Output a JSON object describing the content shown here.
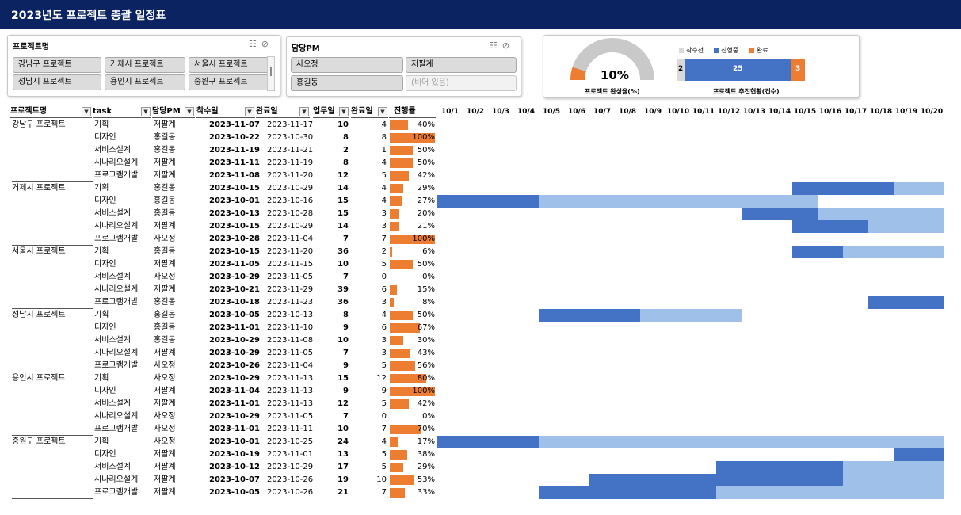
{
  "title": "2023년도 프로젝트 총괄 일정표",
  "slicer_project": {
    "header": "프로젝트명",
    "items": [
      "강남구 프로젝트",
      "거제시 프로젝트",
      "서울시 프로젝트",
      "성남시 프로젝트",
      "용인시 프로젝트",
      "중원구 프로젝트"
    ]
  },
  "slicer_pm": {
    "header": "담당PM",
    "items": [
      "사오정",
      "저팔계",
      "홍길동",
      "(비어 있음)"
    ]
  },
  "kpi": {
    "completion_pct": "10%",
    "completion_value": 0.1,
    "completion_label": "프로젝트 완성율(%)",
    "status_label": "프로젝트 추진현황(건수)",
    "legend": [
      "착수전",
      "진행중",
      "완료"
    ],
    "colors": {
      "before": "#d9d9d9",
      "ongoing": "#4472c4",
      "done": "#ed7d31"
    },
    "counts": {
      "before": "2",
      "ongoing": "25",
      "done": "3"
    }
  },
  "columns": {
    "project": "프로젝트명",
    "task": "task",
    "pm": "담당PM",
    "start": "착수일",
    "end": "완료일",
    "workdays": "업무일",
    "donedays": "완료일",
    "progress": "진행률"
  },
  "dates": [
    "10/1",
    "10/2",
    "10/3",
    "10/4",
    "10/5",
    "10/6",
    "10/7",
    "10/8",
    "10/9",
    "10/10",
    "10/11",
    "10/12",
    "10/13",
    "10/14",
    "10/15",
    "10/16",
    "10/17",
    "10/18",
    "10/19",
    "10/20"
  ],
  "colors": {
    "progress": "#ed7d31",
    "gantt_done": "#4472c4",
    "gantt_remaining": "#9fc0e8",
    "header_bg": "#0b2461"
  },
  "groups": [
    {
      "name": "강남구 프로젝트",
      "rows": [
        {
          "task": "기획",
          "pm": "저팔계",
          "start": "2023-11-07",
          "end": "2023-11-17",
          "wd": "10",
          "cd": "4",
          "pct": "40%"
        },
        {
          "task": "디자인",
          "pm": "홍길동",
          "start": "2023-10-22",
          "end": "2023-10-30",
          "wd": "8",
          "cd": "8",
          "pct": "100%"
        },
        {
          "task": "서비스설계",
          "pm": "홍길동",
          "start": "2023-11-19",
          "end": "2023-11-21",
          "wd": "2",
          "cd": "1",
          "pct": "50%"
        },
        {
          "task": "시나리오설계",
          "pm": "저팔계",
          "start": "2023-11-11",
          "end": "2023-11-19",
          "wd": "8",
          "cd": "4",
          "pct": "50%"
        },
        {
          "task": "프로그램개발",
          "pm": "저팔계",
          "start": "2023-11-08",
          "end": "2023-11-20",
          "wd": "12",
          "cd": "5",
          "pct": "42%"
        }
      ]
    },
    {
      "name": "거제시 프로젝트",
      "rows": [
        {
          "task": "기획",
          "pm": "홍길동",
          "start": "2023-10-15",
          "end": "2023-10-29",
          "wd": "14",
          "cd": "4",
          "pct": "29%"
        },
        {
          "task": "디자인",
          "pm": "홍길동",
          "start": "2023-10-01",
          "end": "2023-10-16",
          "wd": "15",
          "cd": "4",
          "pct": "27%"
        },
        {
          "task": "서비스설계",
          "pm": "홍길동",
          "start": "2023-10-13",
          "end": "2023-10-28",
          "wd": "15",
          "cd": "3",
          "pct": "20%"
        },
        {
          "task": "시나리오설계",
          "pm": "저팔계",
          "start": "2023-10-15",
          "end": "2023-10-29",
          "wd": "14",
          "cd": "3",
          "pct": "21%"
        },
        {
          "task": "프로그램개발",
          "pm": "사오정",
          "start": "2023-10-28",
          "end": "2023-11-04",
          "wd": "7",
          "cd": "7",
          "pct": "100%"
        }
      ]
    },
    {
      "name": "서울시 프로젝트",
      "rows": [
        {
          "task": "기획",
          "pm": "홍길동",
          "start": "2023-10-15",
          "end": "2023-11-20",
          "wd": "36",
          "cd": "2",
          "pct": "6%"
        },
        {
          "task": "디자인",
          "pm": "저팔계",
          "start": "2023-11-05",
          "end": "2023-11-15",
          "wd": "10",
          "cd": "5",
          "pct": "50%"
        },
        {
          "task": "서비스설계",
          "pm": "사오정",
          "start": "2023-10-29",
          "end": "2023-11-05",
          "wd": "7",
          "cd": "0",
          "pct": "0%"
        },
        {
          "task": "시나리오설계",
          "pm": "저팔계",
          "start": "2023-10-21",
          "end": "2023-11-29",
          "wd": "39",
          "cd": "6",
          "pct": "15%"
        },
        {
          "task": "프로그램개발",
          "pm": "홍길동",
          "start": "2023-10-18",
          "end": "2023-11-23",
          "wd": "36",
          "cd": "3",
          "pct": "8%"
        }
      ]
    },
    {
      "name": "성남시 프로젝트",
      "rows": [
        {
          "task": "기획",
          "pm": "홍길동",
          "start": "2023-10-05",
          "end": "2023-10-13",
          "wd": "8",
          "cd": "4",
          "pct": "50%"
        },
        {
          "task": "디자인",
          "pm": "홍길동",
          "start": "2023-11-01",
          "end": "2023-11-10",
          "wd": "9",
          "cd": "6",
          "pct": "67%"
        },
        {
          "task": "서비스설계",
          "pm": "홍길동",
          "start": "2023-10-29",
          "end": "2023-11-08",
          "wd": "10",
          "cd": "3",
          "pct": "30%"
        },
        {
          "task": "시나리오설계",
          "pm": "저팔계",
          "start": "2023-10-29",
          "end": "2023-11-05",
          "wd": "7",
          "cd": "3",
          "pct": "43%"
        },
        {
          "task": "프로그램개발",
          "pm": "사오정",
          "start": "2023-10-26",
          "end": "2023-11-04",
          "wd": "9",
          "cd": "5",
          "pct": "56%"
        }
      ]
    },
    {
      "name": "용인시 프로젝트",
      "rows": [
        {
          "task": "기획",
          "pm": "사오정",
          "start": "2023-10-29",
          "end": "2023-11-13",
          "wd": "15",
          "cd": "12",
          "pct": "80%"
        },
        {
          "task": "디자인",
          "pm": "저팔계",
          "start": "2023-11-04",
          "end": "2023-11-13",
          "wd": "9",
          "cd": "9",
          "pct": "100%"
        },
        {
          "task": "서비스설계",
          "pm": "저팔계",
          "start": "2023-11-01",
          "end": "2023-11-13",
          "wd": "12",
          "cd": "5",
          "pct": "42%"
        },
        {
          "task": "시나리오설계",
          "pm": "사오정",
          "start": "2023-10-29",
          "end": "2023-11-05",
          "wd": "7",
          "cd": "0",
          "pct": "0%"
        },
        {
          "task": "프로그램개발",
          "pm": "사오정",
          "start": "2023-11-01",
          "end": "2023-11-11",
          "wd": "10",
          "cd": "7",
          "pct": "70%"
        }
      ]
    },
    {
      "name": "중원구 프로젝트",
      "rows": [
        {
          "task": "기획",
          "pm": "사오정",
          "start": "2023-10-01",
          "end": "2023-10-25",
          "wd": "24",
          "cd": "4",
          "pct": "17%"
        },
        {
          "task": "디자인",
          "pm": "저팔계",
          "start": "2023-10-19",
          "end": "2023-11-01",
          "wd": "13",
          "cd": "5",
          "pct": "38%"
        },
        {
          "task": "서비스설계",
          "pm": "저팔계",
          "start": "2023-10-12",
          "end": "2023-10-29",
          "wd": "17",
          "cd": "5",
          "pct": "29%"
        },
        {
          "task": "시나리오설계",
          "pm": "저팔계",
          "start": "2023-10-07",
          "end": "2023-10-26",
          "wd": "19",
          "cd": "10",
          "pct": "53%"
        },
        {
          "task": "프로그램개발",
          "pm": "저팔계",
          "start": "2023-10-05",
          "end": "2023-10-26",
          "wd": "21",
          "cd": "7",
          "pct": "33%"
        }
      ]
    }
  ]
}
